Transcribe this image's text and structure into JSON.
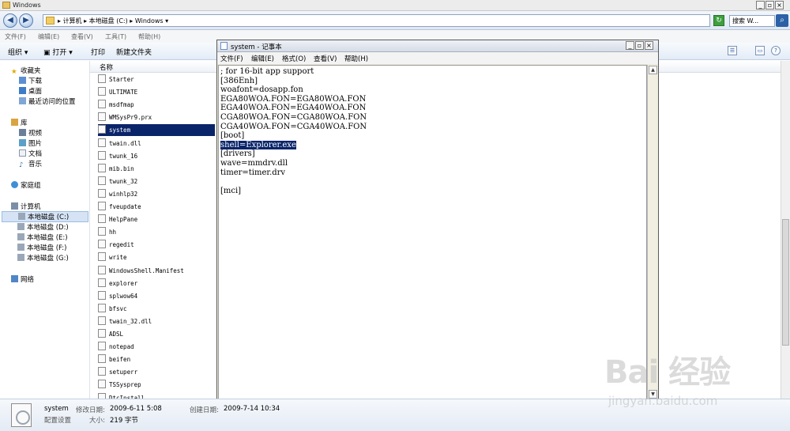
{
  "explorer": {
    "title": "Windows",
    "breadcrumbs": [
      "计算机",
      "本地磁盘 (C:)",
      "Windows"
    ],
    "search_placeholder": "搜索 W...",
    "menu": [
      "文件(F)",
      "编辑(E)",
      "查看(V)",
      "工具(T)",
      "帮助(H)"
    ],
    "toolbar": {
      "organize": "组织",
      "open": "打开",
      "print": "打印",
      "new_folder": "新建文件夹"
    },
    "nav": {
      "favorites": "收藏夹",
      "fav_items": [
        "下载",
        "桌面",
        "最近访问的位置"
      ],
      "library": "库",
      "lib_items": [
        "视频",
        "图片",
        "文档",
        "音乐"
      ],
      "homegroup": "家庭组",
      "computer": "计算机",
      "drives": [
        "本地磁盘 (C:)",
        "本地磁盘 (D:)",
        "本地磁盘 (E:)",
        "本地磁盘 (F:)",
        "本地磁盘 (G:)"
      ],
      "network": "网络"
    },
    "column_name": "名称",
    "files": [
      "Starter",
      "ULTIMATE",
      "msdfmap",
      "WMSysPr9.prx",
      "system",
      "twain.dll",
      "twunk_16",
      "mib.bin",
      "twunk_32",
      "winhlp32",
      "fveupdate",
      "HelpPane",
      "hh",
      "regedit",
      "write",
      "WindowsShell.Manifest",
      "explorer",
      "splwow64",
      "bfsvc",
      "twain_32.dll",
      "ADSL",
      "notepad",
      "beifen",
      "setuperr",
      "TSSysprep",
      "DtcInstall"
    ],
    "selected_file": "system"
  },
  "notepad": {
    "title": "system - 记事本",
    "menu": [
      "文件(F)",
      "编辑(E)",
      "格式(O)",
      "查看(V)",
      "帮助(H)"
    ],
    "lines": [
      "; for 16-bit app support",
      "[386Enh]",
      "woafont=dosapp.fon",
      "EGA80WOA.FON=EGA80WOA.FON",
      "EGA40WOA.FON=EGA40WOA.FON",
      "CGA80WOA.FON=CGA80WOA.FON",
      "CGA40WOA.FON=CGA40WOA.FON",
      "[boot]",
      "shell=Explorer.exe",
      "[drivers]",
      "wave=mmdrv.dll",
      "timer=timer.drv",
      "",
      "[mci]"
    ],
    "highlighted_line": "shell=Explorer.exe"
  },
  "details": {
    "name": "system",
    "modified_label": "修改日期:",
    "modified": "2009-6-11 5:08",
    "created_label": "创建日期:",
    "created": "2009-7-14 10:34",
    "type": "配置设置",
    "size_label": "大小:",
    "size": "219 字节"
  },
  "watermark": {
    "brand": "Bai  经验",
    "url": "jingyan.baidu.com"
  },
  "colors": {
    "selection": "#0a246a",
    "accent": "#2c60a7"
  }
}
